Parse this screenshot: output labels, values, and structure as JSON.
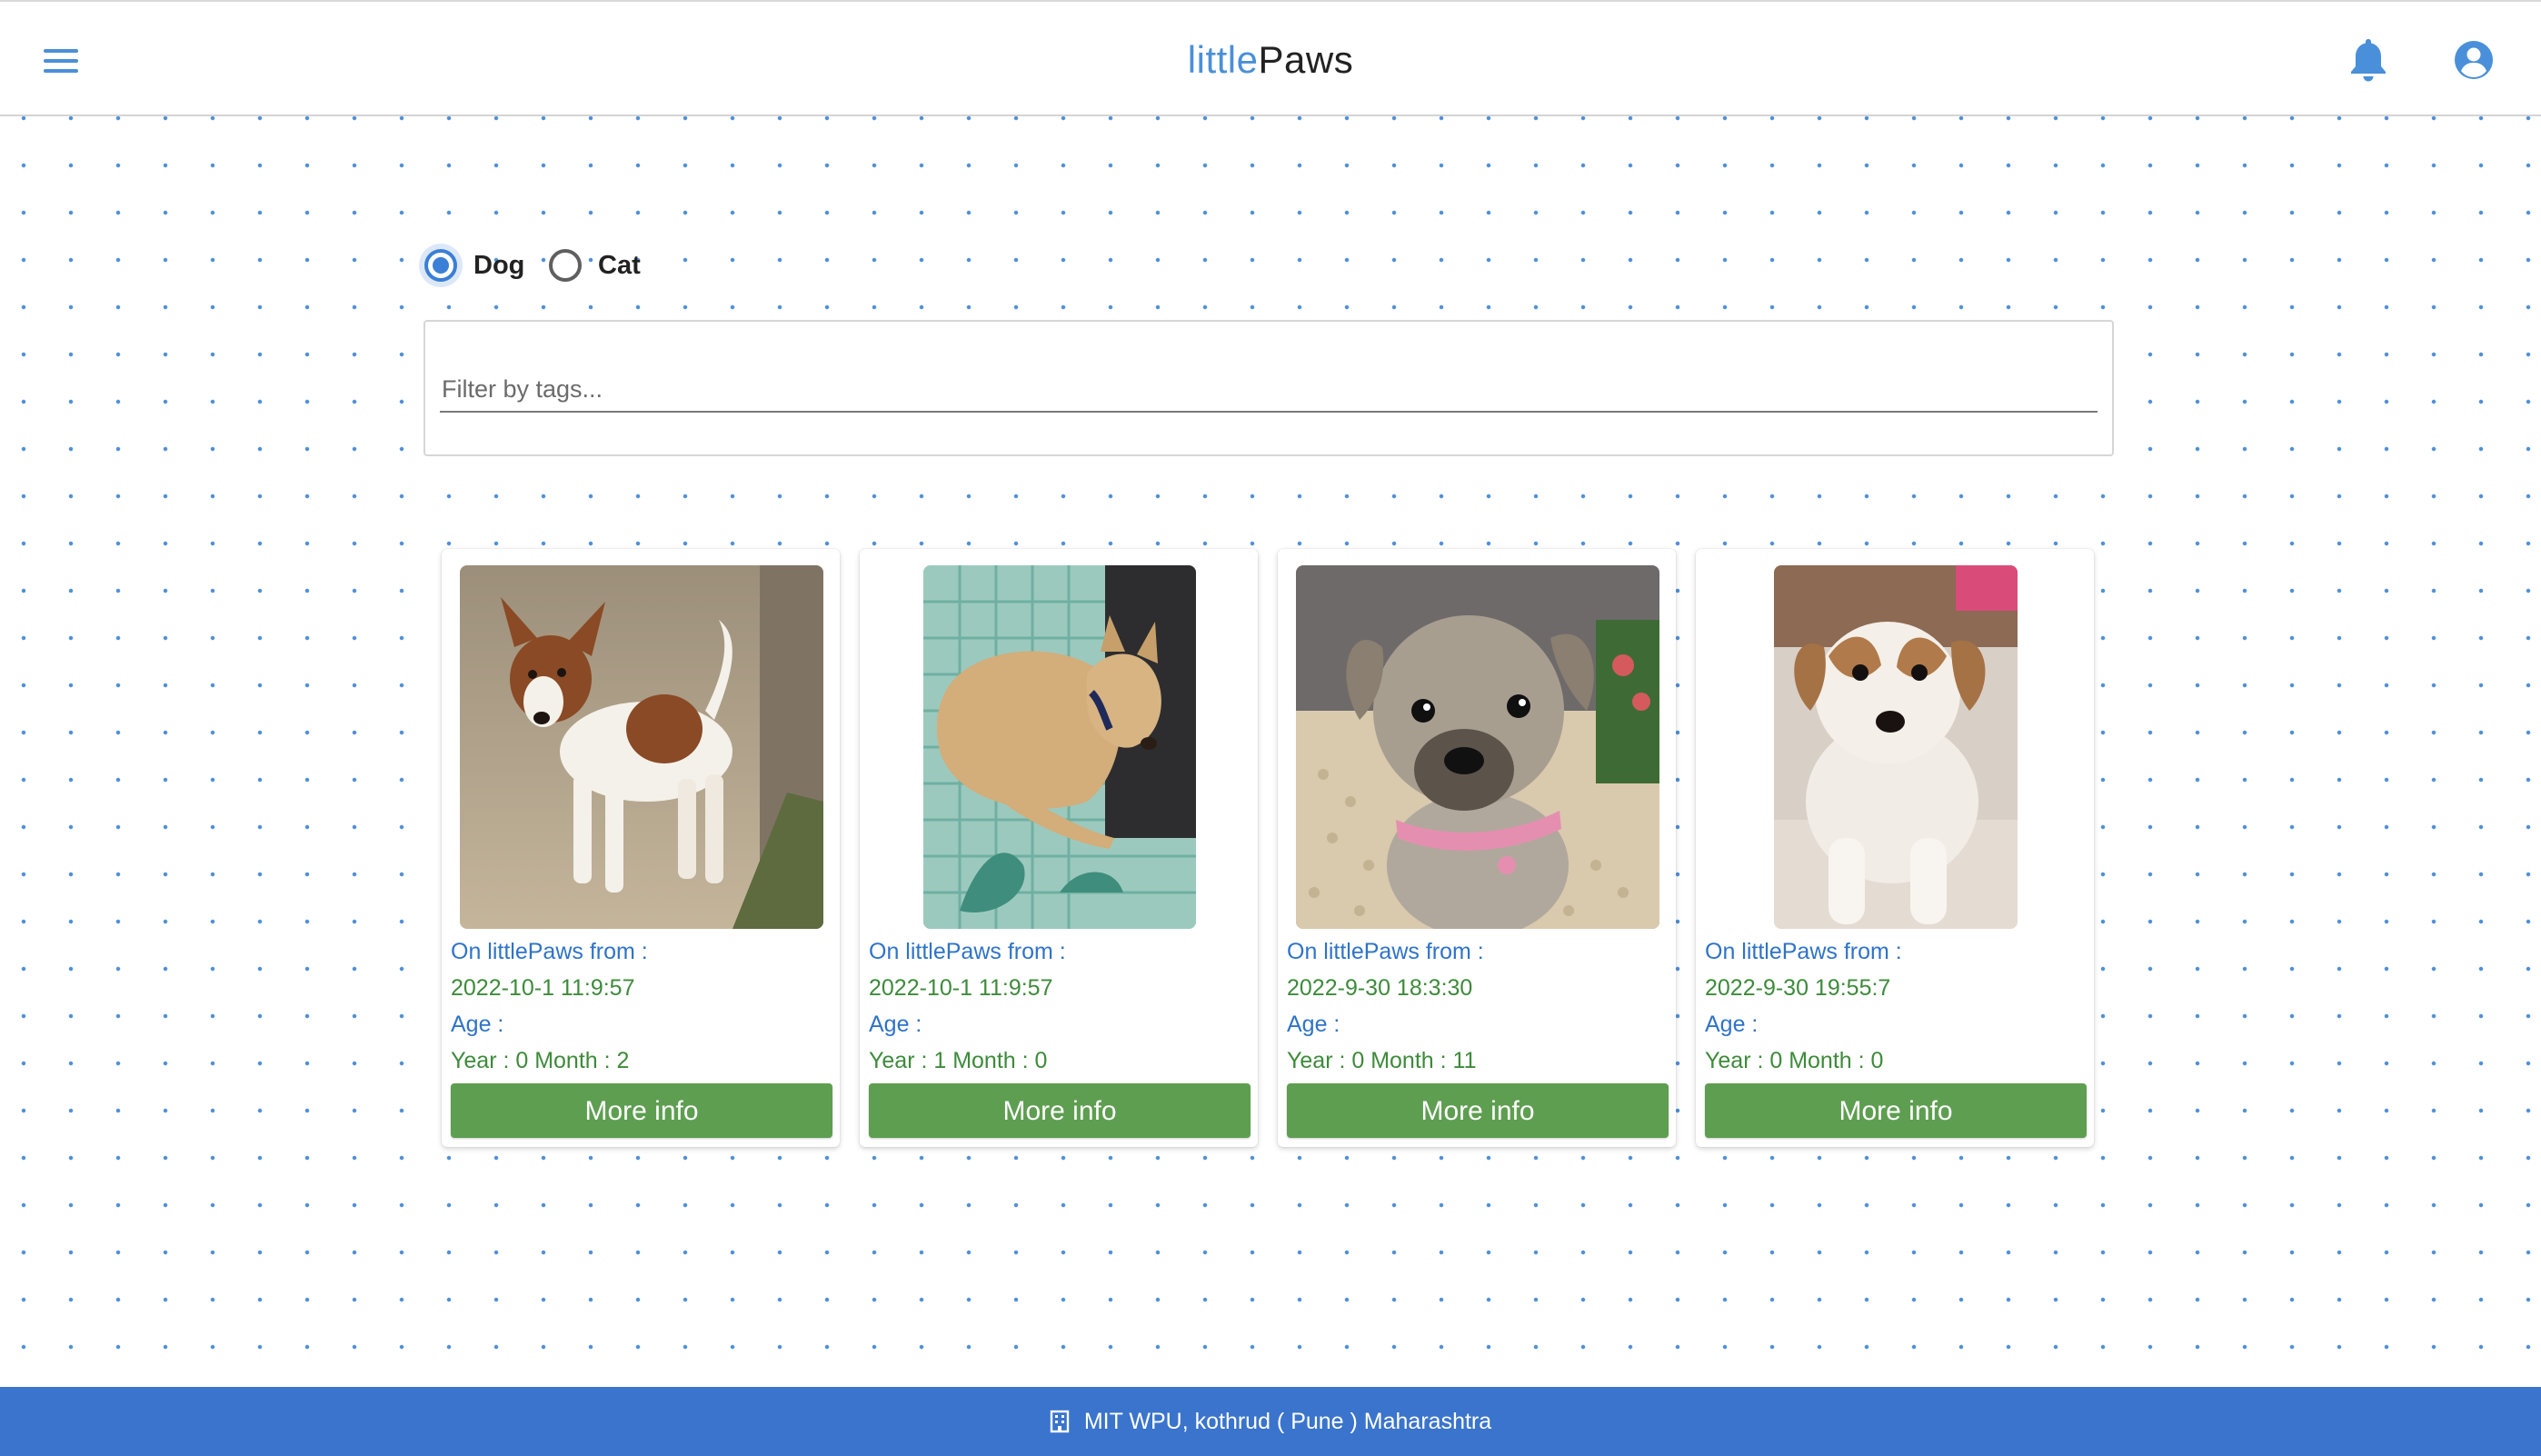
{
  "header": {
    "brand_part1": "little",
    "brand_part2": "Paws",
    "menu_icon": "hamburger-menu-icon",
    "notification_icon": "bell-icon",
    "profile_icon": "account-circle-icon"
  },
  "filters": {
    "pet_type_options": [
      {
        "label": "Dog",
        "checked": true
      },
      {
        "label": "Cat",
        "checked": false
      }
    ],
    "tags_placeholder": "Filter by tags...",
    "tags_value": ""
  },
  "pets": [
    {
      "photo": "brown-white puppy standing on dirt ground",
      "on_since_label": "On littlePaws from :",
      "on_since": "2022-10-1 11:9:57",
      "age_label": "Age :",
      "age": "Year : 0 Month : 2",
      "button": "More info"
    },
    {
      "photo": "tan dog sleeping on a patterned sofa",
      "on_since_label": "On littlePaws from :",
      "on_since": "2022-10-1 11:9:57",
      "age_label": "Age :",
      "age": "Year : 1 Month : 0",
      "button": "More info"
    },
    {
      "photo": "grey puppy with pink collar",
      "on_since_label": "On littlePaws from :",
      "on_since": "2022-9-30 18:3:30",
      "age_label": "Age :",
      "age": "Year : 0 Month : 11",
      "button": "More info"
    },
    {
      "photo": "brown and white puppy lying on floor",
      "on_since_label": "On littlePaws from :",
      "on_since": "2022-9-30 19:55:7",
      "age_label": "Age :",
      "age": "Year : 0 Month : 0",
      "button": "More info"
    }
  ],
  "footer": {
    "icon": "building-icon",
    "address": "MIT WPU, kothrud ( Pune ) Maharashtra"
  },
  "colors": {
    "primary_blue": "#3a74cc",
    "brand_blue": "#4a8fd9",
    "button_green": "#5e9e50",
    "text_green": "#3d8b3a",
    "text_blue": "#2f73c9"
  }
}
